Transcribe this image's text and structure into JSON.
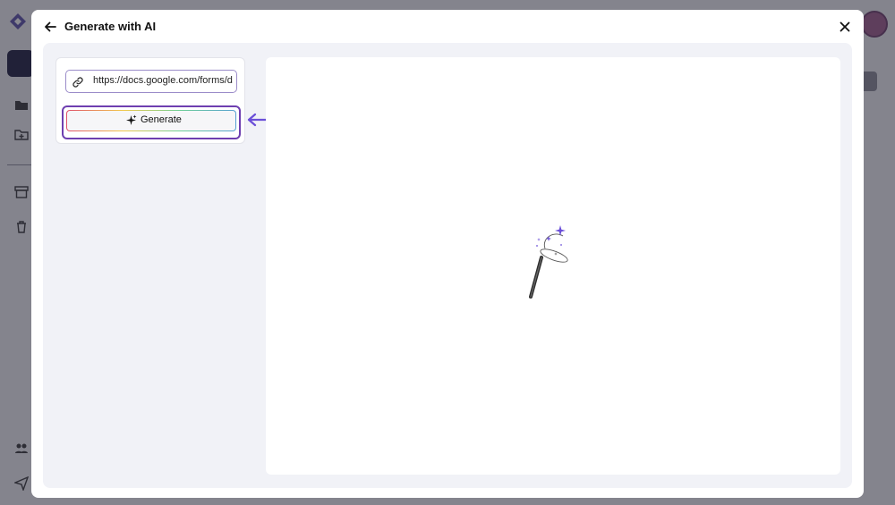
{
  "modal": {
    "title": "Generate with AI",
    "back_icon": "arrow-left-icon",
    "close_icon": "close-icon"
  },
  "form": {
    "url_value": "https://docs.google.com/forms/d/e",
    "link_icon": "link-icon",
    "generate_label": "Generate",
    "generate_icon": "sparkle-icon"
  },
  "preview": {
    "illustration": "magic-wand-icon"
  },
  "colors": {
    "accent": "#6b4fd8",
    "highlight": "#6e3fb0",
    "panel_bg": "#f1f2f7"
  }
}
